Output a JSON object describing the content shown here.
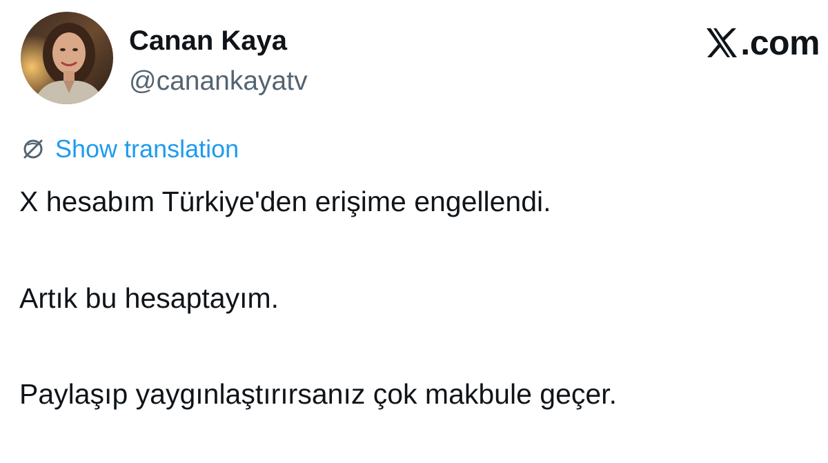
{
  "header": {
    "display_name": "Canan Kaya",
    "handle": "@canankayatv",
    "avatar_icon": "profile-photo",
    "brand": {
      "icon": "x-logo-icon",
      "text": ".com"
    }
  },
  "translation": {
    "icon": "globe-icon",
    "label": "Show translation",
    "color": "#1d9bf0"
  },
  "tweet": {
    "lines": [
      "X hesabım Türkiye'den erişime engellendi.",
      "Artık bu hesaptayım.",
      "Paylaşıp yaygınlaştırırsanız çok makbule geçer."
    ]
  },
  "colors": {
    "text": "#0f1419",
    "secondary": "#536471",
    "link": "#1d9bf0",
    "background": "#ffffff"
  }
}
